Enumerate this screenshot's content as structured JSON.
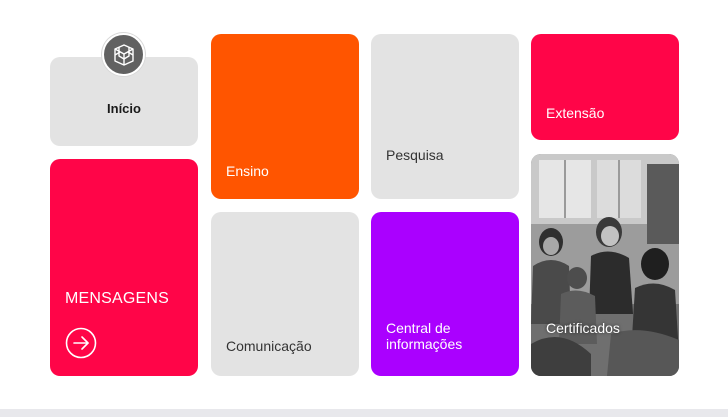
{
  "colors": {
    "light_tile": "#e3e3e3",
    "red": "#ff0548",
    "orange": "#ff5500",
    "purple": "#aa00ff"
  },
  "icons": {
    "logo": "geometric-logo-icon",
    "arrow": "arrow-right-circle-icon"
  },
  "tiles": {
    "inicio": {
      "label": "Início"
    },
    "mensagens": {
      "label": "MENSAGENS"
    },
    "ensino": {
      "label": "Ensino"
    },
    "pesquisa": {
      "label": "Pesquisa"
    },
    "extensao": {
      "label": "Extensão"
    },
    "comunicacao": {
      "label": "Comunicação"
    },
    "central": {
      "label": "Central de informações"
    },
    "certificados": {
      "label": "Certificados"
    }
  }
}
